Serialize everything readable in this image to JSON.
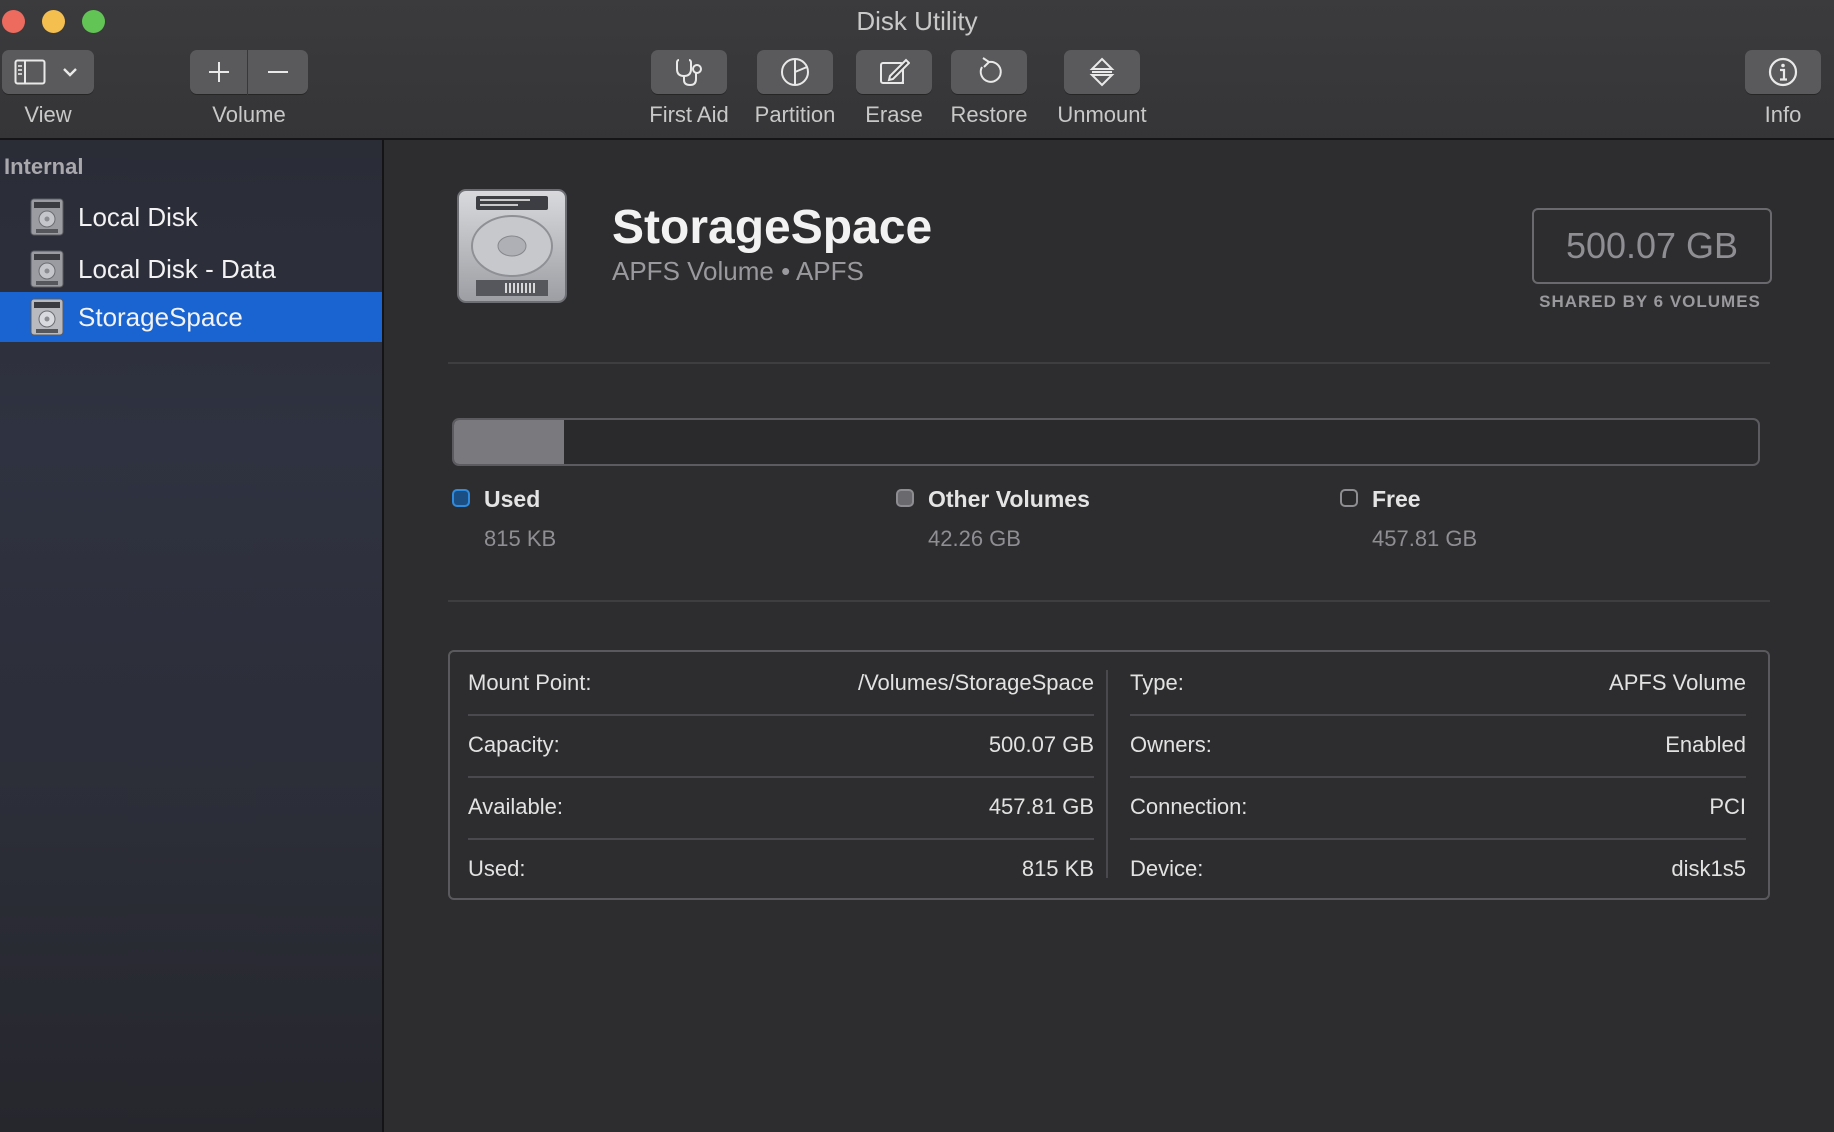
{
  "window": {
    "title": "Disk Utility"
  },
  "toolbar": {
    "view_label": "View",
    "volume_label": "Volume",
    "first_aid_label": "First Aid",
    "partition_label": "Partition",
    "erase_label": "Erase",
    "restore_label": "Restore",
    "unmount_label": "Unmount",
    "info_label": "Info"
  },
  "sidebar": {
    "heading": "Internal",
    "items": [
      {
        "label": "Local Disk",
        "selected": false
      },
      {
        "label": "Local Disk - Data",
        "selected": false
      },
      {
        "label": "StorageSpace",
        "selected": true
      }
    ]
  },
  "volume": {
    "name": "StorageSpace",
    "subtitle": "APFS Volume • APFS",
    "capacity": "500.07 GB",
    "shared_note": "SHARED BY 6 VOLUMES"
  },
  "usage": {
    "used_fraction": 1.6e-06,
    "other_fraction": 0.0845,
    "legend": [
      {
        "label": "Used",
        "value": "815 KB",
        "color": "#1f7fd4"
      },
      {
        "label": "Other Volumes",
        "value": "42.26 GB",
        "color": "#7a7a7e"
      },
      {
        "label": "Free",
        "value": "457.81 GB",
        "color": "#2a2a2c"
      }
    ]
  },
  "info": {
    "left": [
      {
        "key": "Mount Point:",
        "value": "/Volumes/StorageSpace"
      },
      {
        "key": "Capacity:",
        "value": "500.07 GB"
      },
      {
        "key": "Available:",
        "value": "457.81 GB"
      },
      {
        "key": "Used:",
        "value": "815 KB"
      }
    ],
    "right": [
      {
        "key": "Type:",
        "value": "APFS Volume"
      },
      {
        "key": "Owners:",
        "value": "Enabled"
      },
      {
        "key": "Connection:",
        "value": "PCI"
      },
      {
        "key": "Device:",
        "value": "disk1s5"
      }
    ]
  },
  "colors": {
    "accent": "#1a64d2",
    "used": "#1f7fd4",
    "other": "#7a7a7e"
  }
}
